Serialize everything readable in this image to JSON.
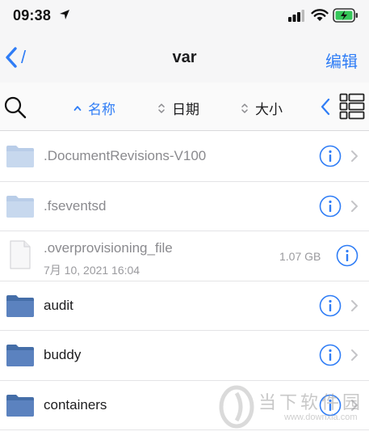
{
  "status_bar": {
    "time": "09:38"
  },
  "nav": {
    "back_label": "/",
    "title": "var",
    "edit_label": "编辑"
  },
  "toolbar": {
    "sort_name": "名称",
    "sort_date": "日期",
    "sort_size": "大小"
  },
  "files": [
    {
      "name": ".DocumentRevisions-V100"
    },
    {
      "name": ".fseventsd"
    },
    {
      "name": ".overprovisioning_file",
      "date": "7月 10, 2021 16:04",
      "size": "1.07 GB"
    },
    {
      "name": "audit"
    },
    {
      "name": "buddy"
    },
    {
      "name": "containers"
    }
  ],
  "watermark": {
    "title": "当下软件园",
    "url": "www.downxia.com"
  },
  "colors": {
    "accent": "#2f7df6",
    "folder_light": "#b9cde8",
    "folder_dark": "#5b82bf",
    "bar_bg": "#f6f6f7"
  }
}
